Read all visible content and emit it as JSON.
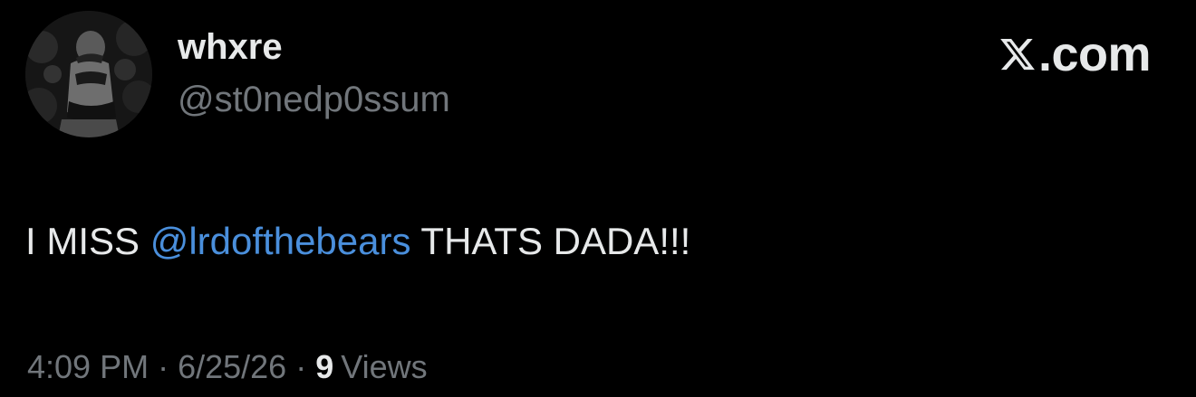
{
  "user": {
    "display_name": "whxre",
    "handle": "@st0nedp0ssum"
  },
  "brand": {
    "logo_icon": "x-logo-icon",
    "text": ".com"
  },
  "tweet": {
    "text_before": "I MISS ",
    "mention": "@lrdofthebears",
    "text_after": " THATS DADA!!!"
  },
  "meta": {
    "time": "4:09 PM",
    "separator": "·",
    "date": "6/25/26",
    "views_count": "9",
    "views_label": "Views"
  },
  "colors": {
    "background": "#000000",
    "primary_text": "#e7e9ea",
    "secondary_text": "#71767b",
    "mention": "#4a8fdc"
  }
}
